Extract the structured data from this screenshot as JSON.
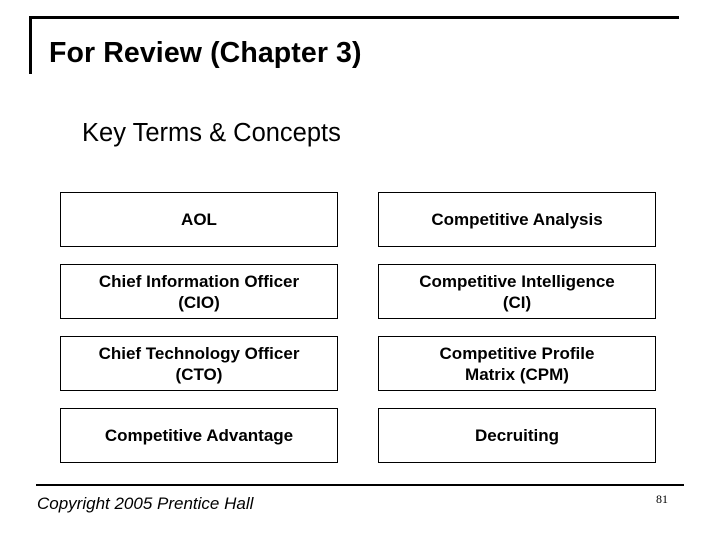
{
  "slide": {
    "title": "For Review (Chapter 3)",
    "subtitle": "Key Terms & Concepts",
    "terms": [
      {
        "label": "AOL"
      },
      {
        "label": "Competitive Analysis"
      },
      {
        "label": "Chief Information Officer\n(CIO)"
      },
      {
        "label": "Competitive Intelligence\n(CI)"
      },
      {
        "label": "Chief Technology Officer\n(CTO)"
      },
      {
        "label": "Competitive Profile\nMatrix (CPM)"
      },
      {
        "label": "Competitive Advantage"
      },
      {
        "label": "Decruiting"
      }
    ],
    "footer": "Copyright 2005 Prentice Hall",
    "page_number": "81"
  }
}
